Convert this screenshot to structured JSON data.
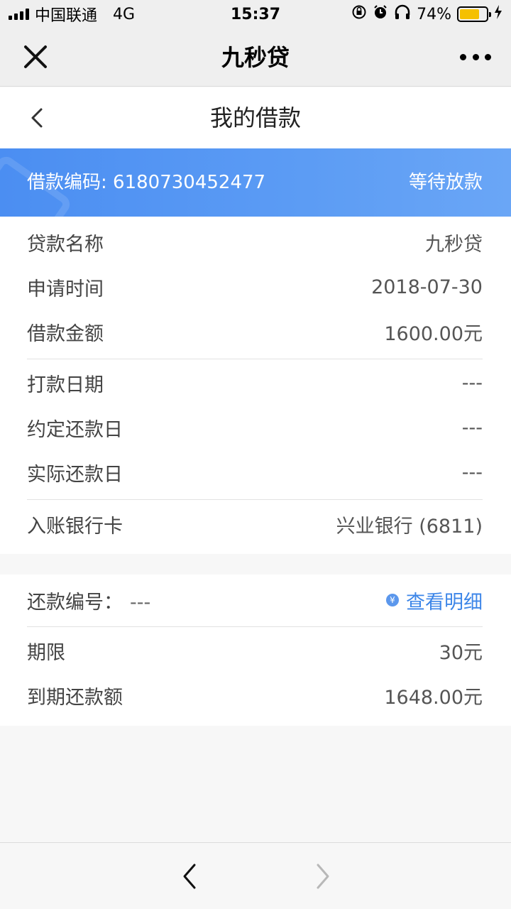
{
  "status_bar": {
    "carrier": "中国联通",
    "network": "4G",
    "time": "15:37",
    "battery": "74%"
  },
  "nav": {
    "title": "九秒贷",
    "close_icon": "close-icon",
    "more_icon": "more-icon"
  },
  "page": {
    "title": "我的借款"
  },
  "banner": {
    "code_label": "借款编码: 6180730452477",
    "status": "等待放款",
    "color": "#4b8ef2"
  },
  "loan_details": [
    {
      "label": "贷款名称",
      "value": "九秒贷"
    },
    {
      "label": "申请时间",
      "value": "2018-07-30"
    },
    {
      "label": "借款金额",
      "value": "1600.00元"
    }
  ],
  "schedule_details": [
    {
      "label": "打款日期",
      "value": "---"
    },
    {
      "label": "约定还款日",
      "value": "---"
    },
    {
      "label": "实际还款日",
      "value": "---"
    }
  ],
  "bank": {
    "label": "入账银行卡",
    "value": "兴业银行 (6811)"
  },
  "repayment": {
    "code_label": "还款编号：",
    "code_value": "---",
    "detail_link": "查看明细",
    "detail_icon_glyph": "¥",
    "link_color": "#3d86e8",
    "rows": [
      {
        "label": "期限",
        "value": "30元"
      },
      {
        "label": "到期还款额",
        "value": "1648.00元"
      }
    ]
  }
}
